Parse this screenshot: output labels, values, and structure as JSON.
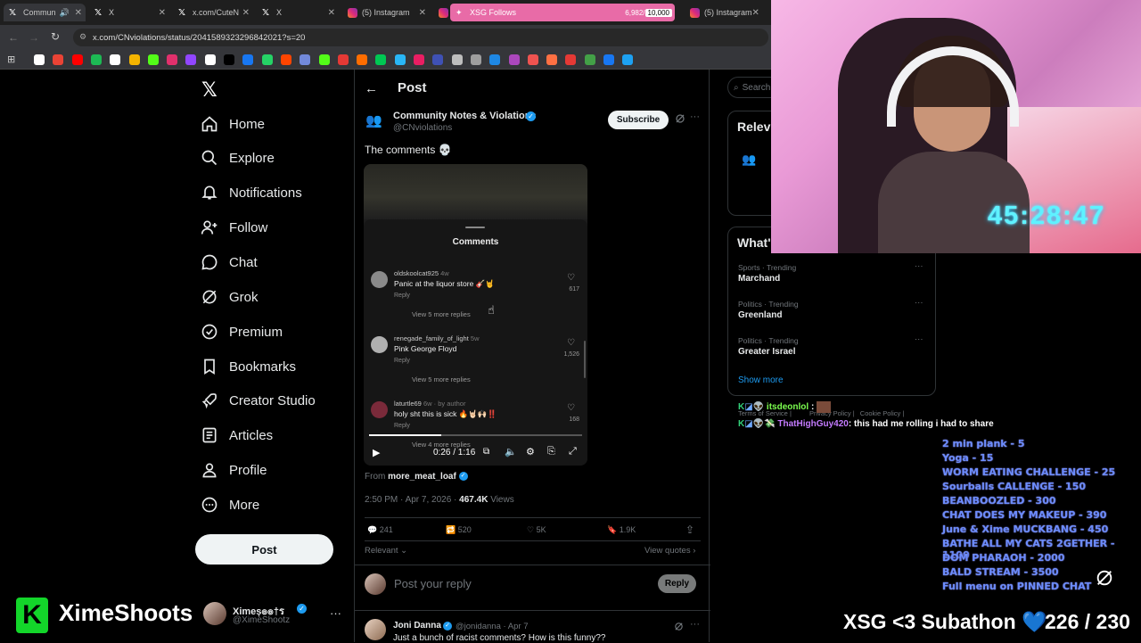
{
  "browser": {
    "tabs": [
      {
        "label": "Commun",
        "active": true
      },
      {
        "label": "X"
      },
      {
        "label": "x.com/CuteN"
      },
      {
        "label": "X"
      },
      {
        "label": "(5) Instagram"
      },
      {
        "label": "XSG Follows",
        "progress_text": "6,982",
        "goal_text": "10,000"
      },
      {
        "label": "(5) Instagram"
      }
    ],
    "url": "x.com/CNviolations/status/2041589323296842021?s=20"
  },
  "nav": {
    "items": [
      {
        "label": "Home"
      },
      {
        "label": "Explore"
      },
      {
        "label": "Notifications"
      },
      {
        "label": "Follow"
      },
      {
        "label": "Chat"
      },
      {
        "label": "Grok"
      },
      {
        "label": "Premium"
      },
      {
        "label": "Bookmarks"
      },
      {
        "label": "Creator Studio"
      },
      {
        "label": "Articles"
      },
      {
        "label": "Profile"
      },
      {
        "label": "More"
      }
    ],
    "post_button": "Post",
    "account_name": "Ximeș๏๏†ร",
    "account_handle": "@XimeShootz"
  },
  "overlay_brand": "XimeShoots",
  "post": {
    "header": "Post",
    "author_name": "Community Notes & Violations",
    "author_handle": "@CNviolations",
    "subscribe": "Subscribe",
    "text": "The comments 💀",
    "video": {
      "panel_title": "Comments",
      "comments": [
        {
          "user": "oldskoolcat925",
          "age": "4w",
          "text": "Panic at the liquor store 🎸🤘",
          "likes": "617",
          "reply": "Reply",
          "more": "View 5 more replies"
        },
        {
          "user": "renegade_family_of_light",
          "age": "5w",
          "text": "Pink George Floyd",
          "likes": "1,526",
          "reply": "Reply",
          "more": "View 5 more replies"
        },
        {
          "user": "laturtle69",
          "age": "6w",
          "by": "by author",
          "text": "holy sht this is sick 🔥🤘🏻🙌🏻‼️",
          "likes": "168",
          "reply": "Reply",
          "more": "View 4 more replies"
        }
      ],
      "time": "0:26 / 1:16",
      "progress": 0.34
    },
    "from_label": "From",
    "from_user": "more_meat_loaf",
    "timestamp": "2:50 PM · Apr 7, 2026 ·",
    "views_count": "467.4K",
    "views_label": "Views",
    "stats": {
      "replies": "241",
      "reposts": "520",
      "likes": "5K",
      "bookmarks": "1.9K"
    },
    "relevant": "Relevant",
    "view_quotes": "View quotes",
    "reply_placeholder": "Post your reply",
    "reply_button": "Reply",
    "reply_author": "Joni Danna",
    "reply_handle": "@jonidanna · Apr 7",
    "reply_text": "Just a bunch of racist comments? How is this funny??"
  },
  "sidebar": {
    "search_placeholder": "Search",
    "relevant_title": "Relev",
    "whats_title": "What'",
    "trends": [
      {
        "meta": "Sports · Trending",
        "name": "Marchand"
      },
      {
        "meta": "Politics · Trending",
        "name": "Greenland"
      },
      {
        "meta": "Politics · Trending",
        "name": "Greater Israel"
      }
    ],
    "show_more": "Show more",
    "footer": [
      "Terms of Service",
      "Privacy Policy",
      "Cookie Policy"
    ]
  },
  "stream": {
    "timer": "45:28:47",
    "chat": [
      {
        "user": "itsdeonlol",
        "text": ":"
      },
      {
        "user": "ThatHighGuy420",
        "text": ": this had me rolling i had to share"
      }
    ],
    "menu": [
      "2 min plank - 5",
      "Yoga - 15",
      "WORM EATING CHALLENGE - 25",
      "Sourballs CALLENGE - 150",
      "BEANBOOZLED - 300",
      "CHAT DOES MY MAKEUP - 390",
      "June & Xime MUCKBANG - 450",
      "BATHE ALL MY CATS 2GETHER - 1100",
      "DOM PHARAOH - 2000",
      "BALD STREAM - 3500",
      "Full menu on PINNED CHAT"
    ],
    "subathon_label": "XSG <3 Subathon",
    "subathon_count": "226 / 230"
  },
  "colors": {
    "accent": "#1d9bf0",
    "bg": "#000000",
    "menu_text": "#6b8cff"
  }
}
